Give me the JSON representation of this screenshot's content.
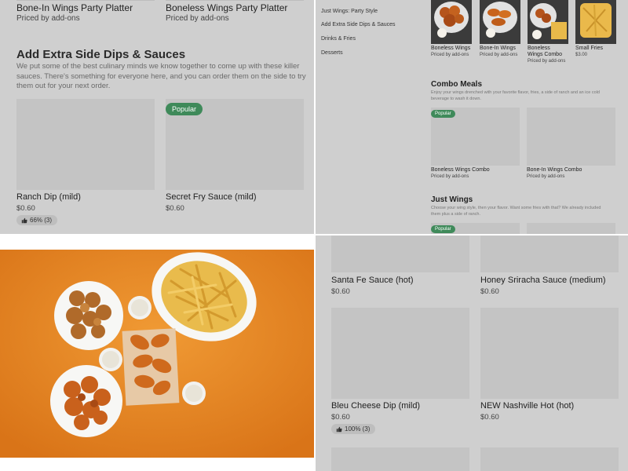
{
  "q1": {
    "top_items": [
      {
        "name": "Bone-In Wings Party Platter",
        "sub": "Priced by add-ons"
      },
      {
        "name": "Boneless Wings Party Platter",
        "sub": "Priced by add-ons"
      }
    ],
    "section": {
      "title": "Add Extra Side Dips & Sauces",
      "description": "We put some of the best culinary minds we know together to come up with these killer sauces. There's something for everyone here, and you can order them on the side to try them out for your next order."
    },
    "items": [
      {
        "name": "Ranch Dip (mild)",
        "price": "$0.60",
        "rating": "66% (3)"
      },
      {
        "name": "Secret Fry Sauce (mild)",
        "price": "$0.60",
        "badge": "Popular"
      }
    ]
  },
  "q2": {
    "sidebar": [
      "Just Wings: Party Style",
      "Add Extra Side Dips & Sauces",
      "Drinks & Fries",
      "Desserts"
    ],
    "top_items": [
      {
        "name": "Boneless Wings",
        "sub": "Priced by add-ons"
      },
      {
        "name": "Bone-In Wings",
        "sub": "Priced by add-ons"
      },
      {
        "name": "Boneless Wings Combo",
        "sub": "Priced by add-ons"
      },
      {
        "name": "Small Fries",
        "sub": "$3.00"
      }
    ],
    "combo": {
      "title": "Combo Meals",
      "description": "Enjoy your wings drenched with your favorite flavor, fries, a side of ranch and an ice cold beverage to wash it down.",
      "badge": "Popular",
      "items": [
        {
          "name": "Boneless Wings Combo",
          "sub": "Priced by add-ons"
        },
        {
          "name": "Bone-In Wings Combo",
          "sub": "Priced by add-ons"
        }
      ]
    },
    "just_wings": {
      "title": "Just Wings",
      "description": "Choose your wing style, then your flavor. Want some fries with that? We already included them plus a side of ranch.",
      "badge": "Popular"
    }
  },
  "q4": {
    "items": [
      {
        "name": "Santa Fe Sauce (hot)",
        "price": "$0.60"
      },
      {
        "name": "Honey Sriracha Sauce (medium)",
        "price": "$0.60"
      },
      {
        "name": "Bleu Cheese Dip (mild)",
        "price": "$0.60",
        "rating": "100% (3)"
      },
      {
        "name": "NEW Nashville Hot (hot)",
        "price": "$0.60"
      }
    ]
  },
  "colors": {
    "badge": "#3f8a5a",
    "panel_bg": "#cfcfcf",
    "placeholder": "#c4c4c4",
    "photo_bg": "#e8841f"
  },
  "icons": [
    "thumbs-up-icon"
  ]
}
